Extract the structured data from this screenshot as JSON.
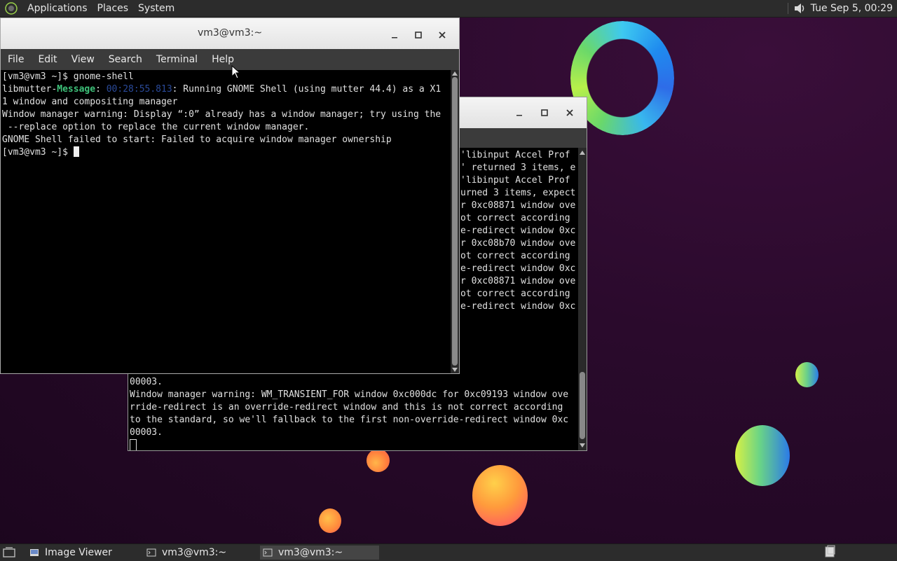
{
  "top_panel": {
    "menus": [
      "Applications",
      "Places",
      "System"
    ],
    "clock": "Tue Sep  5, 00:29",
    "icons": [
      "gnome-foot-icon",
      "volume-icon"
    ]
  },
  "front_terminal": {
    "title": "vm3@vm3:~",
    "menu": [
      "File",
      "Edit",
      "View",
      "Search",
      "Terminal",
      "Help"
    ],
    "lines": {
      "l1": "[vm3@vm3 ~]$ gnome-shell",
      "l2_a": "libmutter-",
      "l2_b": "Message",
      "l2_c": ": ",
      "l2_d": "00:28:55.813",
      "l2_e": ": Running GNOME Shell (using mutter 44.4) as a X1",
      "l3": "1 window and compositing manager",
      "l4": "Window manager warning: Display “:0” already has a window manager; try using the",
      "l5": " --replace option to replace the current window manager.",
      "l6": "GNOME Shell failed to start: Failed to acquire window manager ownership",
      "l7": "[vm3@vm3 ~]$ "
    }
  },
  "back_terminal": {
    "visible_right_lines": [
      "'libinput Accel Prof",
      "' returned 3 items, e",
      "",
      "",
      "'libinput Accel Prof",
      "urned 3 items, expect",
      "",
      "r 0xc08871 window ove",
      "ot correct according",
      "e-redirect window 0xc",
      "",
      "r 0xc08b70 window ove",
      "ot correct according",
      "e-redirect window 0xc",
      "",
      "r 0xc08871 window ove",
      "ot correct according",
      "e-redirect window 0xc"
    ],
    "bottom_lines": [
      "00003.",
      "Window manager warning: WM_TRANSIENT_FOR window 0xc000dc for 0xc09193 window ove",
      "rride-redirect is an override-redirect window and this is not correct according",
      "to the standard, so we'll fallback to the first non-override-redirect window 0xc",
      "00003."
    ]
  },
  "taskbar": {
    "tasks": [
      {
        "label": "Image Viewer",
        "icon": "image-viewer-icon"
      },
      {
        "label": "vm3@vm3:~",
        "icon": "terminal-icon"
      },
      {
        "label": "vm3@vm3:~",
        "icon": "terminal-icon",
        "active": true
      }
    ]
  },
  "colors": {
    "panel": "#2c2c2c",
    "terminal_bg": "#000000",
    "message_green": "#3ec27a",
    "timestamp_blue": "#2a4a9a"
  }
}
